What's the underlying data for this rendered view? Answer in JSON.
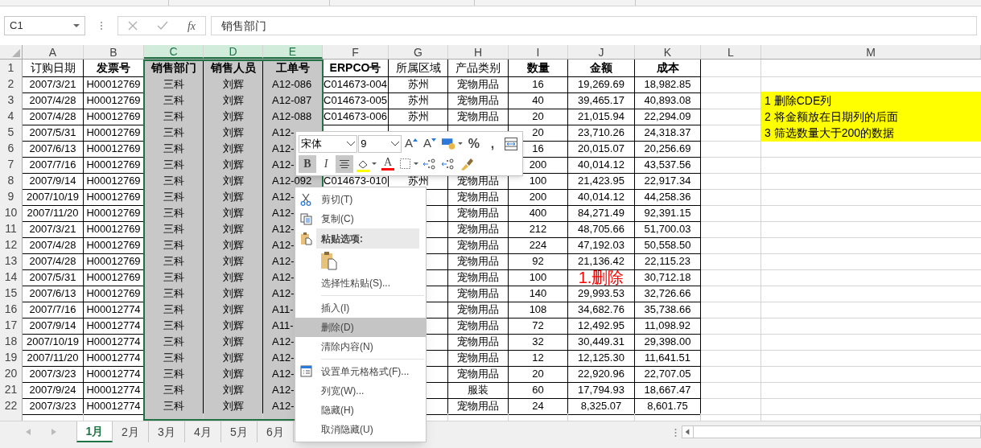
{
  "formula_bar": {
    "name_box": "C1",
    "function_label": "fx",
    "value": "销售部门"
  },
  "columns": [
    {
      "label": "A",
      "selected": false
    },
    {
      "label": "B",
      "selected": false
    },
    {
      "label": "C",
      "selected": true
    },
    {
      "label": "D",
      "selected": true
    },
    {
      "label": "E",
      "selected": true
    },
    {
      "label": "F",
      "selected": false
    },
    {
      "label": "G",
      "selected": false
    },
    {
      "label": "H",
      "selected": false
    },
    {
      "label": "I",
      "selected": false
    },
    {
      "label": "J",
      "selected": false
    },
    {
      "label": "K",
      "selected": false
    },
    {
      "label": "L",
      "selected": false
    },
    {
      "label": "M",
      "selected": false
    }
  ],
  "header_row": {
    "n": "1",
    "cells": [
      {
        "text": "订购日期",
        "bold": false
      },
      {
        "text": "发票号",
        "bold": true
      },
      {
        "text": "销售部门",
        "bold": true
      },
      {
        "text": "销售人员",
        "bold": true
      },
      {
        "text": "工单号",
        "bold": true
      },
      {
        "text": "ERPCO号",
        "bold": true
      },
      {
        "text": "所属区域",
        "bold": false
      },
      {
        "text": "产品类别",
        "bold": false
      },
      {
        "text": "数量",
        "bold": true
      },
      {
        "text": "金额",
        "bold": true
      },
      {
        "text": "成本",
        "bold": true
      }
    ]
  },
  "rows": [
    {
      "n": "2",
      "cells": [
        "2007/3/21",
        "H00012769",
        "三科",
        "刘辉",
        "A12-086",
        "C014673-004",
        "苏州",
        "宠物用品",
        "16",
        "19,269.69",
        "18,982.85"
      ]
    },
    {
      "n": "3",
      "cells": [
        "2007/4/28",
        "H00012769",
        "三科",
        "刘辉",
        "A12-087",
        "C014673-005",
        "苏州",
        "宠物用品",
        "40",
        "39,465.17",
        "40,893.08"
      ],
      "note": "1 删除CDE列"
    },
    {
      "n": "4",
      "cells": [
        "2007/4/28",
        "H00012769",
        "三科",
        "刘辉",
        "A12-088",
        "C014673-006",
        "苏州",
        "宠物用品",
        "20",
        "21,015.94",
        "22,294.09"
      ],
      "note": "2 将金额放在日期列的后面"
    },
    {
      "n": "5",
      "cells": [
        "2007/5/31",
        "H00012769",
        "三科",
        "刘辉",
        "A12-",
        null,
        null,
        null,
        "20",
        "23,710.26",
        "24,318.37"
      ],
      "note": "3 筛选数量大于200的数据"
    },
    {
      "n": "6",
      "cells": [
        "2007/6/13",
        "H00012769",
        "三科",
        "刘辉",
        "A12-",
        null,
        null,
        null,
        "16",
        "20,015.07",
        "20,256.69"
      ]
    },
    {
      "n": "7",
      "cells": [
        "2007/7/16",
        "H00012769",
        "三科",
        "刘辉",
        "A12-",
        null,
        null,
        null,
        "200",
        "40,014.12",
        "43,537.56"
      ]
    },
    {
      "n": "8",
      "cells": [
        "2007/9/14",
        "H00012769",
        "三科",
        "刘辉",
        "A12-092",
        "C014673-010",
        "苏州",
        "宠物用品",
        "100",
        "21,423.95",
        "22,917.34"
      ]
    },
    {
      "n": "9",
      "cells": [
        "2007/10/19",
        "H00012769",
        "三科",
        "刘辉",
        "A12-",
        null,
        null,
        "宠物用品",
        "200",
        "40,014.12",
        "44,258.36"
      ]
    },
    {
      "n": "10",
      "cells": [
        "2007/11/20",
        "H00012769",
        "三科",
        "刘辉",
        "A12-",
        null,
        null,
        "宠物用品",
        "400",
        "84,271.49",
        "92,391.15"
      ]
    },
    {
      "n": "11",
      "cells": [
        "2007/3/21",
        "H00012769",
        "三科",
        "刘辉",
        "A12-",
        null,
        null,
        "宠物用品",
        "212",
        "48,705.66",
        "51,700.03"
      ]
    },
    {
      "n": "12",
      "cells": [
        "2007/4/28",
        "H00012769",
        "三科",
        "刘辉",
        "A12-",
        null,
        null,
        "宠物用品",
        "224",
        "47,192.03",
        "50,558.50"
      ]
    },
    {
      "n": "13",
      "cells": [
        "2007/4/28",
        "H00012769",
        "三科",
        "刘辉",
        "A12-",
        null,
        null,
        "宠物用品",
        "92",
        "21,136.42",
        "22,115.23"
      ]
    },
    {
      "n": "14",
      "cells": [
        "2007/5/31",
        "H00012769",
        "三科",
        "刘辉",
        "A12-",
        null,
        null,
        "宠物用品",
        "100",
        null,
        "30,712.18"
      ],
      "annotation": "1.删除"
    },
    {
      "n": "15",
      "cells": [
        "2007/6/13",
        "H00012769",
        "三科",
        "刘辉",
        "A12-",
        null,
        null,
        "宠物用品",
        "140",
        "29,993.53",
        "32,726.66"
      ]
    },
    {
      "n": "16",
      "cells": [
        "2007/7/16",
        "H00012774",
        "三科",
        "刘辉",
        "A11-",
        null,
        null,
        "宠物用品",
        "108",
        "34,682.76",
        "35,738.66"
      ]
    },
    {
      "n": "17",
      "cells": [
        "2007/9/14",
        "H00012774",
        "三科",
        "刘辉",
        "A11-",
        null,
        null,
        "宠物用品",
        "72",
        "12,492.95",
        "11,098.92"
      ]
    },
    {
      "n": "18",
      "cells": [
        "2007/10/19",
        "H00012774",
        "三科",
        "刘辉",
        "A12-",
        null,
        null,
        "宠物用品",
        "32",
        "30,449.31",
        "29,398.00"
      ]
    },
    {
      "n": "19",
      "cells": [
        "2007/11/20",
        "H00012774",
        "三科",
        "刘辉",
        "A12-",
        null,
        null,
        "宠物用品",
        "12",
        "12,125.30",
        "11,641.51"
      ]
    },
    {
      "n": "20",
      "cells": [
        "2007/3/23",
        "H00012774",
        "三科",
        "刘辉",
        "A12-",
        null,
        null,
        "宠物用品",
        "20",
        "22,920.96",
        "22,707.05"
      ]
    },
    {
      "n": "21",
      "cells": [
        "2007/9/24",
        "H00012774",
        "三科",
        "刘辉",
        "A12-",
        null,
        null,
        "服装",
        "60",
        "17,794.93",
        "18,667.47"
      ]
    },
    {
      "n": "22",
      "cells": [
        "2007/3/23",
        "H00012774",
        "三科",
        "刘辉",
        "A12-",
        null,
        null,
        "宠物用品",
        "24",
        "8,325.07",
        "8,601.75"
      ]
    }
  ],
  "mini_toolbar": {
    "font": "宋体",
    "size": "9",
    "row1": [
      {
        "kind": "grow",
        "label": "A"
      },
      {
        "kind": "shrink",
        "label": "A"
      },
      {
        "kind": "accounting"
      },
      {
        "kind": "text",
        "label": "%"
      },
      {
        "kind": "text",
        "label": ","
      },
      {
        "kind": "wrap"
      }
    ],
    "row2": [
      {
        "kind": "bold",
        "label": "B",
        "on": true
      },
      {
        "kind": "italic",
        "label": "I",
        "on": false
      },
      {
        "kind": "align",
        "on": true
      },
      {
        "kind": "fill",
        "color": "#ffff00"
      },
      {
        "kind": "fontcolor",
        "label": "A",
        "color": "#ff0000"
      },
      {
        "kind": "border"
      },
      {
        "kind": "inc-decimal"
      },
      {
        "kind": "dec-decimal"
      },
      {
        "kind": "painter"
      }
    ]
  },
  "context_menu": [
    {
      "kind": "cut",
      "label": "剪切(T)",
      "selected": false
    },
    {
      "kind": "copy",
      "label": "复制(C)",
      "selected": false
    },
    {
      "kind": "paste-header",
      "label": "粘贴选项:"
    },
    {
      "kind": "paste-button"
    },
    {
      "kind": "item",
      "label": "选择性粘贴(S)...",
      "selected": false
    },
    {
      "kind": "separator"
    },
    {
      "kind": "item",
      "label": "插入(I)",
      "selected": false
    },
    {
      "kind": "item",
      "label": "删除(D)",
      "selected": true
    },
    {
      "kind": "item",
      "label": "清除内容(N)",
      "selected": false
    },
    {
      "kind": "separator"
    },
    {
      "kind": "format",
      "label": "设置单元格格式(F)...",
      "selected": false
    },
    {
      "kind": "item",
      "label": "列宽(W)...",
      "selected": false
    },
    {
      "kind": "item",
      "label": "隐藏(H)",
      "selected": false
    },
    {
      "kind": "item",
      "label": "取消隐藏(U)",
      "selected": false
    }
  ],
  "sheet_tabs": [
    {
      "label": "1月",
      "selected": true
    },
    {
      "label": "2月",
      "selected": false
    },
    {
      "label": "3月",
      "selected": false
    },
    {
      "label": "4月",
      "selected": false
    },
    {
      "label": "5月",
      "selected": false
    },
    {
      "label": "6月",
      "selected": false
    }
  ]
}
